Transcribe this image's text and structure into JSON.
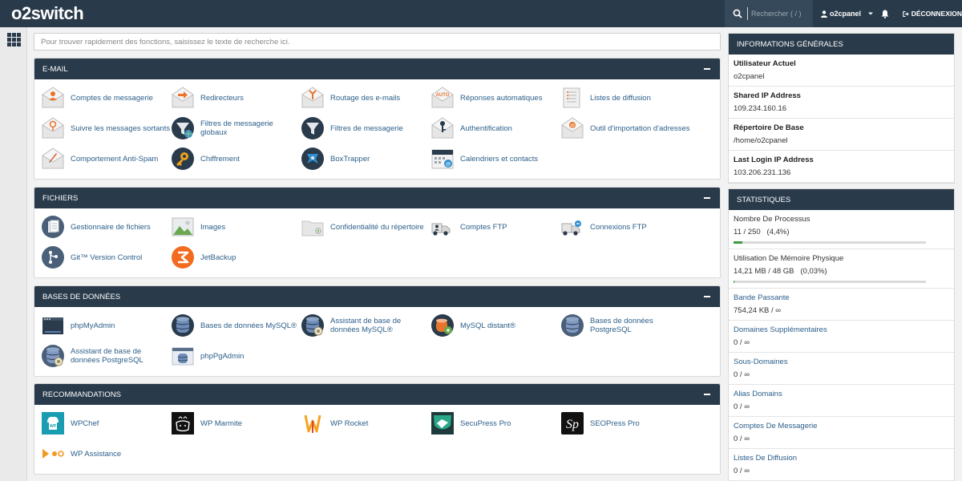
{
  "header": {
    "logo": "o2switch",
    "search_placeholder": "Rechercher ( / )",
    "user": "o2cpanel",
    "logout": "DÉCONNEXION"
  },
  "quick_search_placeholder": "Pour trouver rapidement des fonctions, saisissez le texte de recherche ici.",
  "sections": [
    {
      "title": "E-MAIL",
      "items": [
        {
          "label": "Comptes de messagerie",
          "icon": "email-accounts-icon"
        },
        {
          "label": "Redirecteurs",
          "icon": "forwarders-icon"
        },
        {
          "label": "Routage des e-mails",
          "icon": "email-routing-icon"
        },
        {
          "label": "Réponses automatiques",
          "icon": "autoresponders-icon"
        },
        {
          "label": "Listes de diffusion",
          "icon": "mailing-lists-icon"
        },
        {
          "label": "Suivre les messages sortants",
          "icon": "track-delivery-icon"
        },
        {
          "label": "Filtres de messagerie globaux",
          "icon": "global-filters-icon"
        },
        {
          "label": "Filtres de messagerie",
          "icon": "email-filters-icon"
        },
        {
          "label": "Authentification",
          "icon": "authentication-icon"
        },
        {
          "label": "Outil d'importation d'adresses",
          "icon": "address-importer-icon"
        },
        {
          "label": "Comportement Anti-Spam",
          "icon": "spam-icon"
        },
        {
          "label": "Chiffrement",
          "icon": "encryption-icon"
        },
        {
          "label": "BoxTrapper",
          "icon": "boxtrapper-icon"
        },
        {
          "label": "Calendriers et contacts",
          "icon": "calendar-contacts-icon"
        }
      ]
    },
    {
      "title": "FICHIERS",
      "items": [
        {
          "label": "Gestionnaire de fichiers",
          "icon": "file-manager-icon"
        },
        {
          "label": "Images",
          "icon": "images-icon"
        },
        {
          "label": "Confidentialité du répertoire",
          "icon": "directory-privacy-icon"
        },
        {
          "label": "Comptes FTP",
          "icon": "ftp-accounts-icon"
        },
        {
          "label": "Connexions FTP",
          "icon": "ftp-connections-icon"
        },
        {
          "label": "Git™ Version Control",
          "icon": "git-icon"
        },
        {
          "label": "JetBackup",
          "icon": "jetbackup-icon"
        }
      ]
    },
    {
      "title": "BASES DE DONNÉES",
      "items": [
        {
          "label": "phpMyAdmin",
          "icon": "phpmyadmin-icon"
        },
        {
          "label": "Bases de données MySQL®",
          "icon": "mysql-databases-icon"
        },
        {
          "label": "Assistant de base de données MySQL®",
          "icon": "mysql-wizard-icon"
        },
        {
          "label": "MySQL distant®",
          "icon": "remote-mysql-icon"
        },
        {
          "label": "Bases de données PostgreSQL",
          "icon": "postgresql-databases-icon"
        },
        {
          "label": "Assistant de base de données PostgreSQL",
          "icon": "postgresql-wizard-icon"
        },
        {
          "label": "phpPgAdmin",
          "icon": "phppgadmin-icon"
        }
      ]
    },
    {
      "title": "RECOMMANDATIONS",
      "items": [
        {
          "label": "WPChef",
          "icon": "wpchef-icon"
        },
        {
          "label": "WP Marmite",
          "icon": "wp-marmite-icon"
        },
        {
          "label": "WP Rocket",
          "icon": "wp-rocket-icon"
        },
        {
          "label": "SecuPress Pro",
          "icon": "secupress-icon"
        },
        {
          "label": "SEOPress Pro",
          "icon": "seopress-icon"
        },
        {
          "label": "WP Assistance",
          "icon": "wp-assistance-icon"
        }
      ]
    }
  ],
  "general_info": {
    "title": "INFORMATIONS GÉNÉRALES",
    "rows": [
      {
        "label": "Utilisateur Actuel",
        "value": "o2cpanel"
      },
      {
        "label": "Shared IP Address",
        "value": "109.234.160.16"
      },
      {
        "label": "Répertoire De Base",
        "value": "/home/o2cpanel"
      },
      {
        "label": "Last Login IP Address",
        "value": "103.206.231.136"
      }
    ]
  },
  "stats": {
    "title": "STATISTIQUES",
    "rows": [
      {
        "label": "Nombre De Processus",
        "value": "11 / 250   (4,4%)",
        "fraction": 0.044
      },
      {
        "label": "Utilisation De Mémoire Physique",
        "value": "14,21 MB / 48 GB   (0,03%)",
        "fraction": 0.0003
      },
      {
        "label": "Bande Passante",
        "value": "754,24 KB / ∞"
      },
      {
        "label": "Domaines Supplémentaires",
        "value": "0 / ∞"
      },
      {
        "label": "Sous-Domaines",
        "value": "0 / ∞"
      },
      {
        "label": "Alias Domains",
        "value": "0 / ∞"
      },
      {
        "label": "Comptes De Messagerie",
        "value": "0 / ∞"
      },
      {
        "label": "Listes De Diffusion",
        "value": "0 / ∞"
      }
    ]
  },
  "colors": {
    "header": "#293a4a",
    "link": "#2c5f8a",
    "progress": "#3d9b3d"
  }
}
